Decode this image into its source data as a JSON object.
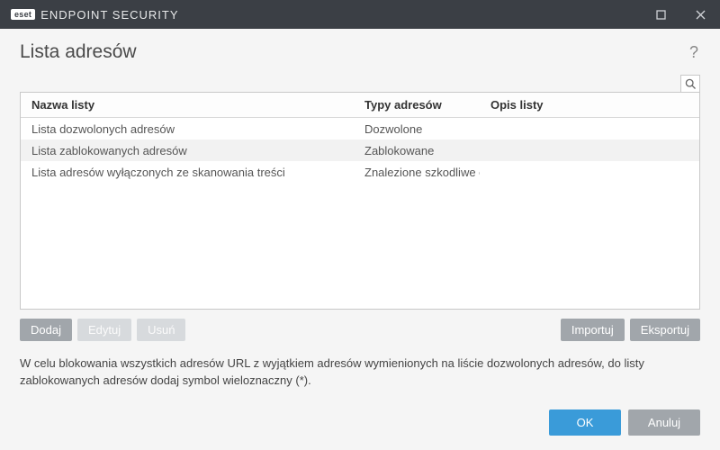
{
  "brand_box": "eset",
  "brand_text": "ENDPOINT SECURITY",
  "page_title": "Lista adresów",
  "columns": {
    "name": "Nazwa listy",
    "type": "Typy adresów",
    "desc": "Opis listy"
  },
  "rows": [
    {
      "name": "Lista dozwolonych adresów",
      "type": "Dozwolone",
      "desc": ""
    },
    {
      "name": "Lista zablokowanych adresów",
      "type": "Zablokowane",
      "desc": ""
    },
    {
      "name": "Lista adresów wyłączonych ze skanowania treści",
      "type": "Znalezione szkodliwe opr...",
      "desc": ""
    }
  ],
  "buttons": {
    "add": "Dodaj",
    "edit": "Edytuj",
    "remove": "Usuń",
    "import": "Importuj",
    "export": "Eksportuj"
  },
  "note_text": "W celu blokowania wszystkich adresów URL z wyjątkiem adresów wymienionych na liście dozwolonych adresów, do listy zablokowanych adresów dodaj symbol wieloznaczny (*).",
  "footer": {
    "ok": "OK",
    "cancel": "Anuluj"
  }
}
